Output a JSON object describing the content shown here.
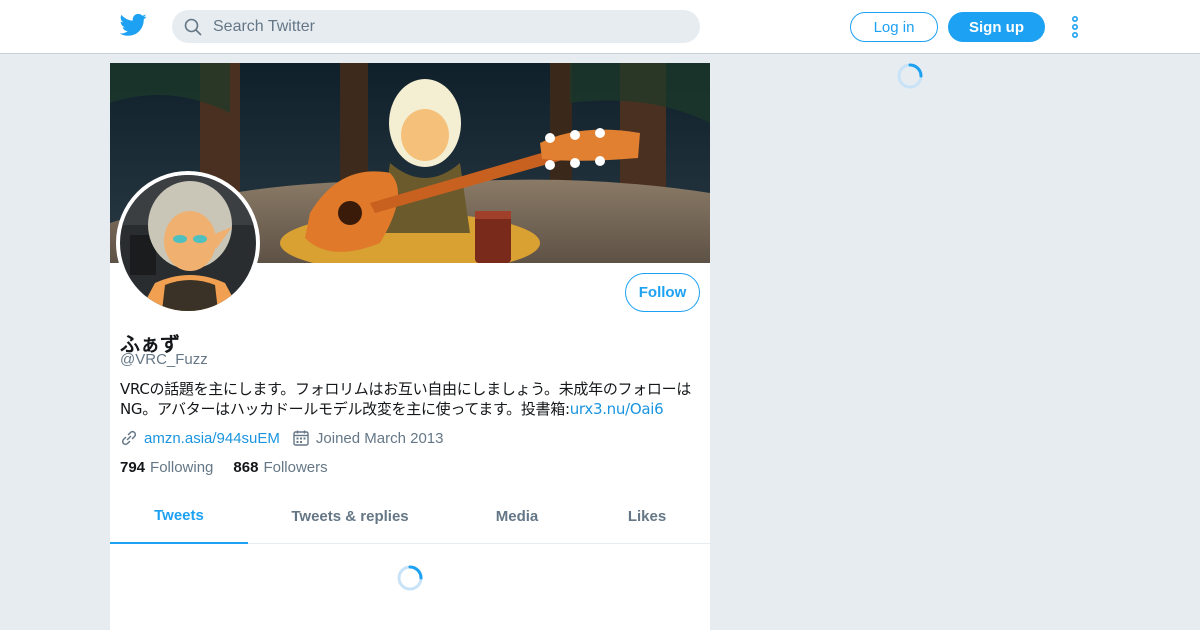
{
  "header": {
    "search_placeholder": "Search Twitter",
    "login_label": "Log in",
    "signup_label": "Sign up"
  },
  "profile": {
    "display_name": "ふぁず",
    "handle": "@VRC_Fuzz",
    "bio_text": "VRCの話題を主にします。フォロリムはお互い自由にしましょう。未成年のフォローはNG。アバターはハッカドールモデル改変を主に使ってます。投書箱:",
    "bio_link": "urx3.nu/Oai6",
    "website": "amzn.asia/944suEM",
    "joined": "Joined March 2013",
    "follow_label": "Follow",
    "following_count": "794",
    "following_label": "Following",
    "followers_count": "868",
    "followers_label": "Followers"
  },
  "tabs": [
    {
      "label": "Tweets",
      "active": true
    },
    {
      "label": "Tweets & replies",
      "active": false
    },
    {
      "label": "Media",
      "active": false
    },
    {
      "label": "Likes",
      "active": false
    }
  ],
  "colors": {
    "accent": "#1da1f2",
    "background": "#e6ecf0",
    "secondary_text": "#657786"
  }
}
